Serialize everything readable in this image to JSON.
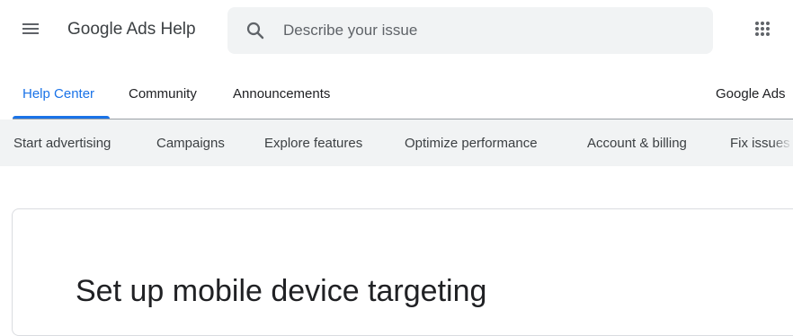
{
  "header": {
    "menu_icon": "hamburger-menu-icon",
    "product_name": "Google Ads Help",
    "search": {
      "placeholder": "Describe your issue",
      "value": "",
      "icon": "search-icon"
    },
    "apps_icon": "apps-grid-icon"
  },
  "tabs": {
    "items": [
      {
        "label": "Help Center",
        "active": true
      },
      {
        "label": "Community",
        "active": false
      },
      {
        "label": "Announcements",
        "active": false
      }
    ],
    "product_link": "Google Ads"
  },
  "subnav": {
    "items": [
      {
        "label": "Start advertising"
      },
      {
        "label": "Campaigns"
      },
      {
        "label": "Explore features"
      },
      {
        "label": "Optimize performance"
      },
      {
        "label": "Account & billing"
      },
      {
        "label": "Fix issues"
      }
    ]
  },
  "article": {
    "title": "Set up mobile device targeting"
  },
  "colors": {
    "accent": "#1a73e8",
    "text": "#202124",
    "secondary_text": "#5f6368",
    "surface": "#f1f3f4",
    "border": "#dadce0"
  }
}
